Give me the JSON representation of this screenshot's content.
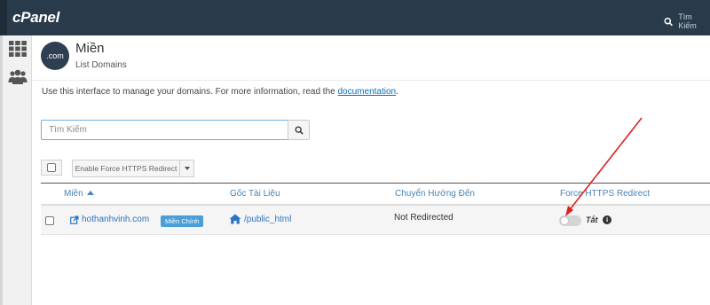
{
  "app": {
    "name": "cPanel"
  },
  "header": {
    "search_label": "Tìm Kiếm"
  },
  "sidebar": {
    "items": [
      {
        "icon": "grid-icon"
      },
      {
        "icon": "users-icon"
      }
    ]
  },
  "page": {
    "icon_text": ".com",
    "title": "Miền",
    "subtitle": "List Domains",
    "description_prefix": "Use this interface to manage your domains. For more information, read the ",
    "description_link": "documentation",
    "description_suffix": "."
  },
  "search": {
    "placeholder": "Tìm Kiếm"
  },
  "toolbar": {
    "force_https_label": "Enable Force HTTPS Redirect"
  },
  "table": {
    "columns": [
      {
        "label": "Miền",
        "sorted": "asc"
      },
      {
        "label": "Gốc Tài Liệu"
      },
      {
        "label": "Chuyển Hướng Đến"
      },
      {
        "label": "Force HTTPS Redirect"
      }
    ],
    "rows": [
      {
        "domain": "hothanhvinh.com",
        "badge": "Miền Chính",
        "document_root": "/public_html",
        "redirects_to": "Not Redirected",
        "force_https": "Tắt"
      }
    ]
  },
  "colors": {
    "topbar": "#293a4a",
    "link": "#2b74c4",
    "badge": "#4a9fd8",
    "annotation_arrow": "#e02020"
  }
}
